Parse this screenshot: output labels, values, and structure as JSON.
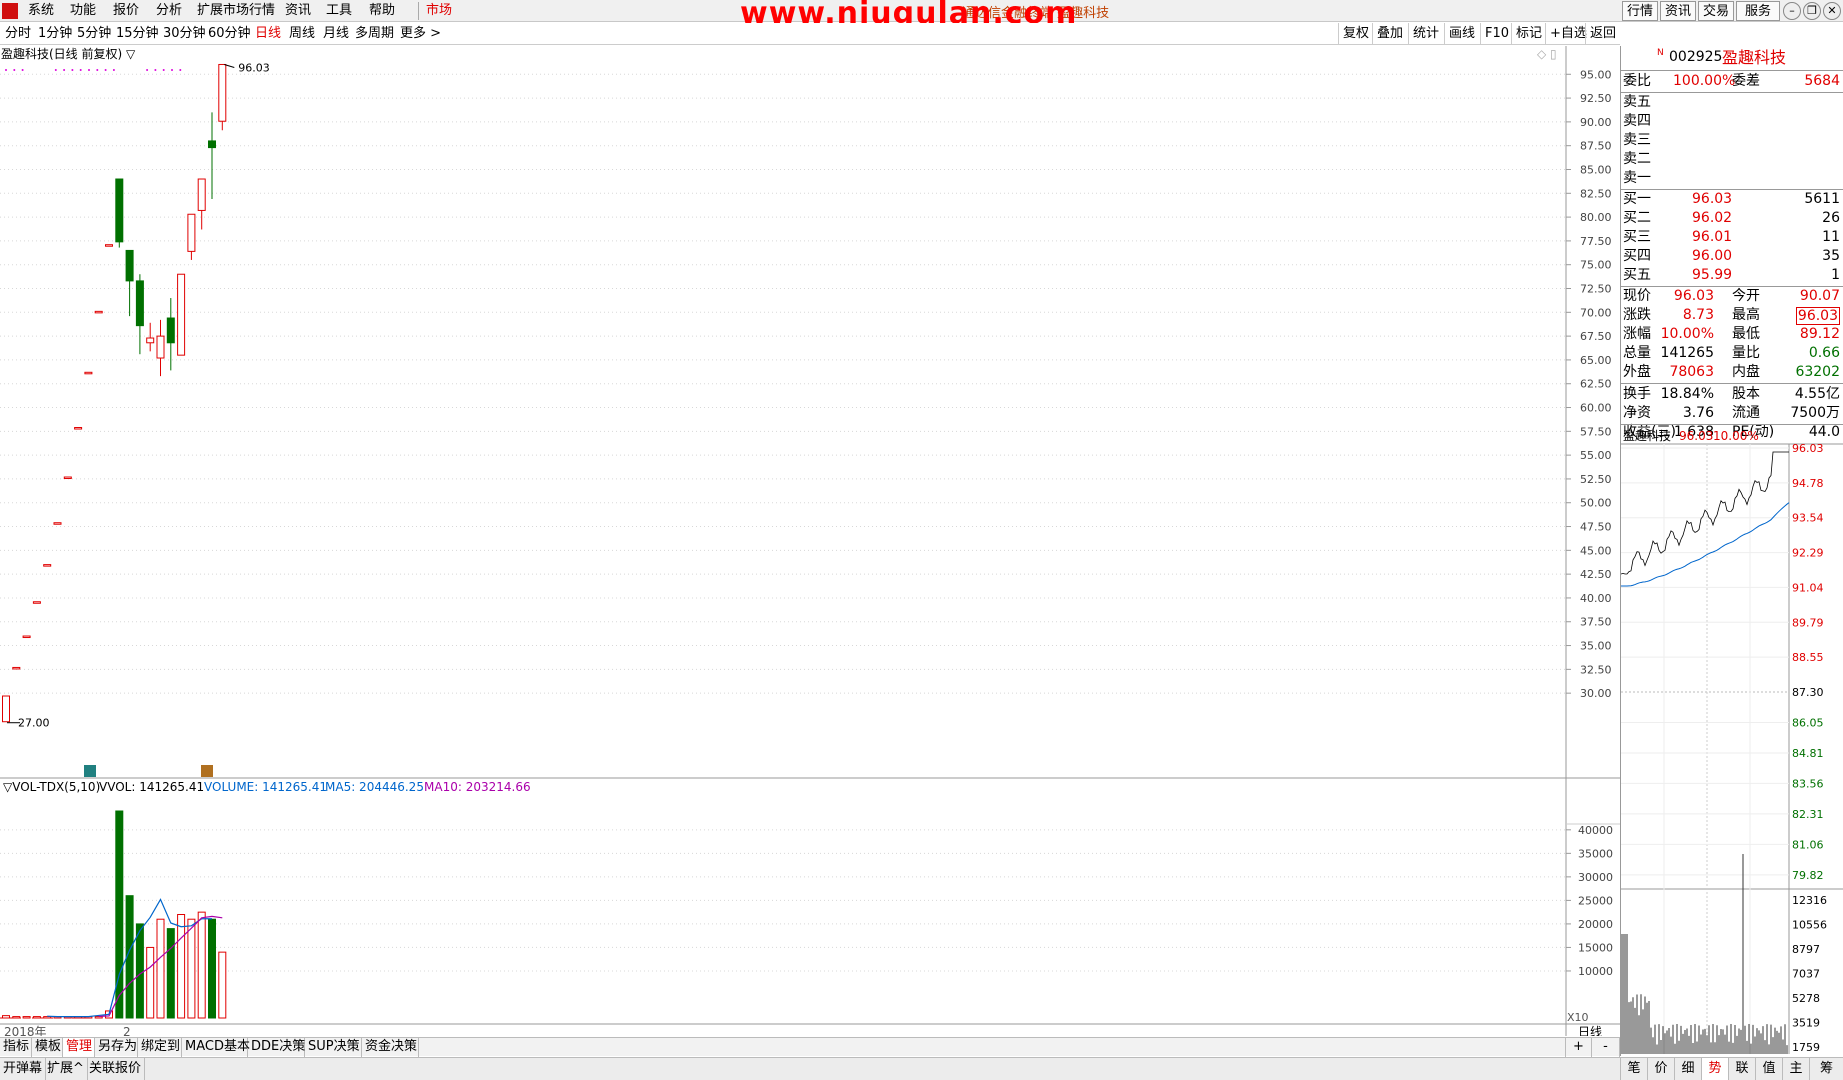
{
  "menubar": {
    "items": [
      "系统",
      "功能",
      "报价",
      "分析",
      "扩展市场行情",
      "资讯",
      "工具",
      "帮助",
      "市场"
    ],
    "watermark": "www.niugulan.com",
    "title": "通达信金融终端 盈趣科技",
    "right_buttons": [
      "行情",
      "资讯",
      "交易",
      "服务"
    ]
  },
  "periods": [
    "分时",
    "1分钟",
    "5分钟",
    "15分钟",
    "30分钟",
    "60分钟",
    "日线",
    "周线",
    "月线",
    "多周期",
    "更多 >"
  ],
  "active_period": "日线",
  "toolbar": [
    "复权",
    "叠加",
    "统计",
    "画线",
    "F10",
    "标记",
    "+自选",
    "返回"
  ],
  "chart_title": "盈趣科技(日线 前复权) ▽",
  "volume_header": {
    "name": "▽VOL-TDX(5,10)",
    "vvol": "VVOL: 141265.41",
    "volume": "VOLUME: 141265.41",
    "ma5": "MA5: 204446.25",
    "ma10": "MA10: 203214.66"
  },
  "xaxis": {
    "year": "2018年",
    "month": "2",
    "period_label": "日线",
    "zoom_label": "X10"
  },
  "colors": {
    "up": "#e00000",
    "down": "#007000",
    "ma5": "#0066cc",
    "ma10": "#aa00aa",
    "pink_dots": "#dd00dd"
  },
  "chart_data": {
    "type": "candlestick",
    "price_axis": [
      "95.00",
      "92.50",
      "90.00",
      "87.50",
      "85.00",
      "82.50",
      "80.00",
      "77.50",
      "75.00",
      "72.50",
      "70.00",
      "67.50",
      "65.00",
      "62.50",
      "60.00",
      "57.50",
      "55.00",
      "52.50",
      "50.00",
      "47.50",
      "45.00",
      "42.50",
      "40.00",
      "37.50",
      "35.00",
      "32.50",
      "30.00"
    ],
    "ylim": [
      25.5,
      96.5
    ],
    "high_label": "96.03",
    "low_label": "27.00",
    "candles": [
      {
        "o": 27.0,
        "h": 29.7,
        "l": 27.0,
        "c": 29.7
      },
      {
        "o": 32.7,
        "h": 32.7,
        "l": 32.7,
        "c": 32.7
      },
      {
        "o": 36.0,
        "h": 36.0,
        "l": 36.0,
        "c": 36.0
      },
      {
        "o": 39.6,
        "h": 39.6,
        "l": 39.6,
        "c": 39.6
      },
      {
        "o": 43.5,
        "h": 43.5,
        "l": 43.5,
        "c": 43.5
      },
      {
        "o": 47.9,
        "h": 47.9,
        "l": 47.9,
        "c": 47.9
      },
      {
        "o": 52.7,
        "h": 52.7,
        "l": 52.7,
        "c": 52.7
      },
      {
        "o": 57.9,
        "h": 57.9,
        "l": 57.9,
        "c": 57.9
      },
      {
        "o": 63.7,
        "h": 63.7,
        "l": 63.7,
        "c": 63.7
      },
      {
        "o": 70.1,
        "h": 70.1,
        "l": 70.1,
        "c": 70.1
      },
      {
        "o": 77.1,
        "h": 77.1,
        "l": 77.1,
        "c": 77.1
      },
      {
        "o": 84.0,
        "h": 84.0,
        "l": 76.8,
        "c": 77.4
      },
      {
        "o": 76.5,
        "h": 76.5,
        "l": 69.6,
        "c": 73.3
      },
      {
        "o": 73.3,
        "h": 74.0,
        "l": 65.6,
        "c": 68.6
      },
      {
        "o": 66.8,
        "h": 68.9,
        "l": 65.9,
        "c": 67.3
      },
      {
        "o": 65.2,
        "h": 69.2,
        "l": 63.3,
        "c": 67.5
      },
      {
        "o": 69.4,
        "h": 71.5,
        "l": 63.9,
        "c": 66.8
      },
      {
        "o": 65.5,
        "h": 74.0,
        "l": 65.5,
        "c": 74.0
      },
      {
        "o": 76.4,
        "h": 80.3,
        "l": 75.5,
        "c": 80.3
      },
      {
        "o": 80.7,
        "h": 84.0,
        "l": 78.7,
        "c": 84.0
      },
      {
        "o": 88.0,
        "h": 91.0,
        "l": 81.9,
        "c": 87.3
      },
      {
        "o": 90.07,
        "h": 96.03,
        "l": 89.12,
        "c": 96.03
      }
    ],
    "volume_axis": [
      "40000",
      "35000",
      "30000",
      "25000",
      "20000",
      "15000",
      "10000"
    ],
    "volume_ylim": [
      0,
      44000
    ],
    "volumes": [
      500,
      300,
      300,
      300,
      300,
      300,
      300,
      300,
      300,
      300,
      1500,
      44000,
      26000,
      20000,
      15000,
      21000,
      19000,
      22000,
      21000,
      22500,
      21000,
      14000
    ],
    "ma5": [
      null,
      null,
      null,
      null,
      380,
      300,
      300,
      300,
      300,
      540,
      780,
      9280,
      14420,
      18560,
      21400,
      25200,
      20200,
      19400,
      19600,
      21100,
      21100,
      null
    ],
    "ma10": [
      null,
      null,
      null,
      null,
      null,
      null,
      null,
      null,
      null,
      340,
      440,
      4810,
      7380,
      9350,
      10820,
      12900,
      14800,
      17000,
      19100,
      21300,
      21600,
      21300
    ]
  },
  "quote": {
    "code_flag": "N",
    "code": "002925",
    "name": "盈趣科技",
    "weibi_label": "委比",
    "weibi": "100.00%",
    "weicha_label": "委差",
    "weicha": "5684",
    "sells": [
      {
        "label": "卖五"
      },
      {
        "label": "卖四"
      },
      {
        "label": "卖三"
      },
      {
        "label": "卖二"
      },
      {
        "label": "卖一"
      }
    ],
    "buys": [
      {
        "label": "买一",
        "price": "96.03",
        "vol": "5611"
      },
      {
        "label": "买二",
        "price": "96.02",
        "vol": "26"
      },
      {
        "label": "买三",
        "price": "96.01",
        "vol": "11"
      },
      {
        "label": "买四",
        "price": "96.00",
        "vol": "35"
      },
      {
        "label": "买五",
        "price": "95.99",
        "vol": "1"
      }
    ],
    "stats": [
      {
        "l1": "现价",
        "v1": "96.03",
        "c1": "red",
        "l2": "今开",
        "v2": "90.07",
        "c2": "red"
      },
      {
        "l1": "涨跌",
        "v1": "8.73",
        "c1": "red",
        "l2": "最高",
        "v2": "96.03",
        "c2": "red"
      },
      {
        "l1": "涨幅",
        "v1": "10.00%",
        "c1": "red",
        "l2": "最低",
        "v2": "89.12",
        "c2": "red"
      },
      {
        "l1": "总量",
        "v1": "141265",
        "c1": "black",
        "l2": "量比",
        "v2": "0.66",
        "c2": "green"
      },
      {
        "l1": "外盘",
        "v1": "78063",
        "c1": "red",
        "l2": "内盘",
        "v2": "63202",
        "c2": "green"
      }
    ],
    "stats2": [
      {
        "l1": "换手",
        "v1": "18.84%",
        "l2": "股本",
        "v2": "4.55亿"
      },
      {
        "l1": "净资",
        "v1": "3.76",
        "l2": "流通",
        "v2": "7500万"
      },
      {
        "l1": "收益(三)",
        "v1": "1.638",
        "l2": "PE(动)",
        "v2": "44.0"
      }
    ]
  },
  "mini_chart": {
    "title": "盈趣科技",
    "price": "96.03",
    "pct": "10.00%",
    "price_labels_up": [
      "96.03",
      "94.78",
      "93.54",
      "92.29",
      "91.04",
      "89.79",
      "88.55"
    ],
    "mid_label": "87.30",
    "price_labels_down": [
      "86.05",
      "84.81",
      "83.56",
      "82.31",
      "81.06",
      "79.82"
    ],
    "vol_labels": [
      "12316",
      "10556",
      "8797",
      "7037",
      "5278",
      "3519",
      "1759"
    ]
  },
  "bottom_tabs": [
    "指标",
    "模板",
    "管理",
    "另存为",
    "绑定到",
    "MACD基本",
    "DDE决策",
    "SUP决策",
    "资金决策"
  ],
  "active_bottom_tab": "管理",
  "bottom_controls": [
    "+",
    "-"
  ],
  "status_items": [
    "开弹幕",
    "扩展^",
    "关联报价"
  ],
  "right_tabs": [
    "笔",
    "价",
    "细",
    "势",
    "联",
    "值",
    "主",
    "筹"
  ],
  "active_right_tab": "势"
}
